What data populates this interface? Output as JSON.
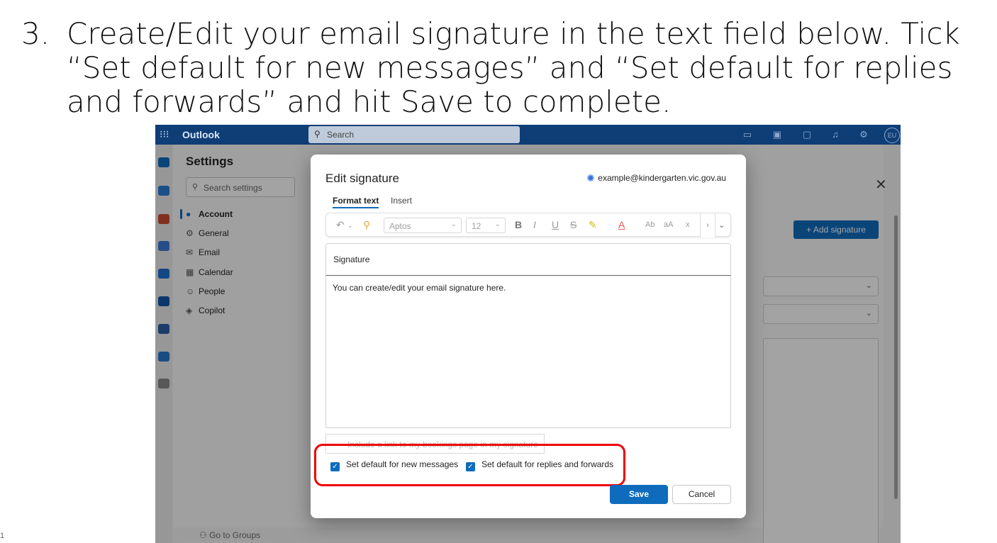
{
  "instruction": {
    "number": "3.",
    "text": "Create/Edit your email signature in the text field below. Tick “Set default for new messages” and “Set default for replies and forwards” and hit Save to complete."
  },
  "slide_number": "1",
  "topbar": {
    "app_name": "Outlook",
    "search_placeholder": "Search",
    "avatar_initials": "EU"
  },
  "settings": {
    "title": "Settings",
    "search_placeholder": "Search settings",
    "nav": [
      {
        "label": "Account",
        "icon": "person-icon"
      },
      {
        "label": "General",
        "icon": "gear-icon"
      },
      {
        "label": "Email",
        "icon": "mail-icon"
      },
      {
        "label": "Calendar",
        "icon": "calendar-icon"
      },
      {
        "label": "People",
        "icon": "people-icon"
      },
      {
        "label": "Copilot",
        "icon": "copilot-icon"
      }
    ],
    "go_to_groups": "Go to Groups",
    "add_signature": "Add signature"
  },
  "dialog": {
    "title": "Edit signature",
    "account": "example@kindergarten.vic.gov.au",
    "tabs": [
      "Format text",
      "Insert"
    ],
    "font": "Aptos",
    "font_size": "12",
    "signature_name": "Signature",
    "signature_body": "You can create/edit your email signature here.",
    "bookings_link": "Include a link to my bookings page in my signature",
    "default_new": "Set default for new messages",
    "default_replies": "Set default for replies and forwards",
    "save": "Save",
    "cancel": "Cancel"
  },
  "colors": {
    "topbar": "#0f3e77",
    "accent": "#0f6cbd",
    "highlight": "#ee0000"
  }
}
